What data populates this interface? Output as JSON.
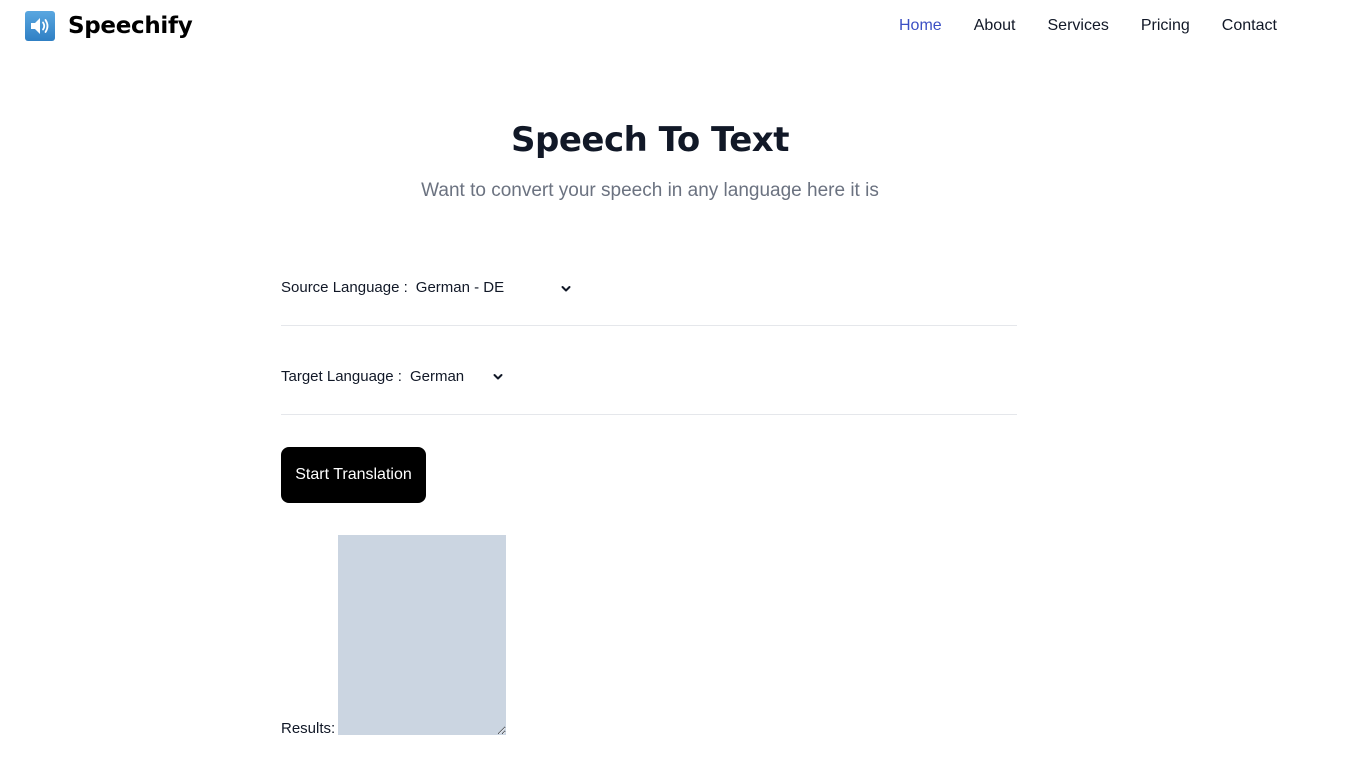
{
  "brand": {
    "name": "Speechify",
    "icon": "speaker-icon",
    "icon_color": "#3b8ad0"
  },
  "nav": {
    "items": [
      "Home",
      "About",
      "Services",
      "Pricing",
      "Contact"
    ],
    "active": "Home",
    "active_color": "#3b4fc4"
  },
  "hero": {
    "title": "Speech To Text",
    "subtitle": "Want to convert your speech in any language here it is"
  },
  "form": {
    "source_label": "Source Language :",
    "source_value": "German - DE",
    "target_label": "Target Language :",
    "target_value": "German",
    "start_button": "Start Translation",
    "results_label": "Results:",
    "results_value": "",
    "results_bg": "#cbd5e1"
  }
}
